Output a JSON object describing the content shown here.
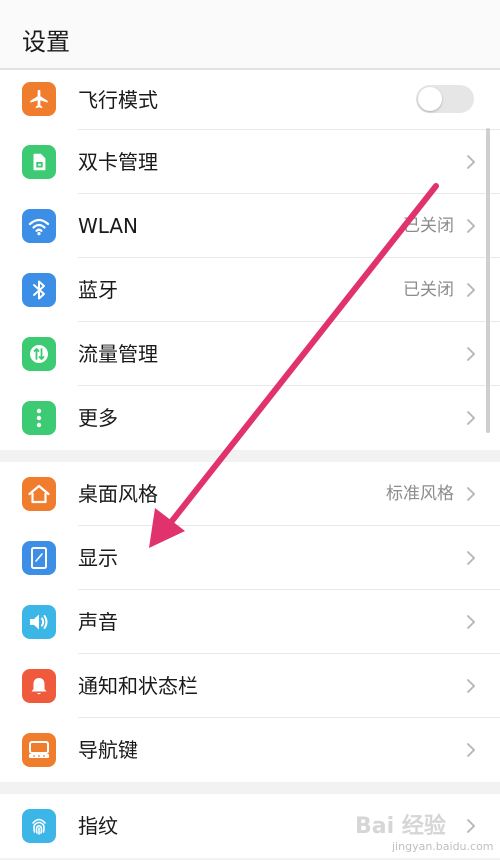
{
  "header": {
    "title": "设置"
  },
  "colors": {
    "airplane": "#f07d2d",
    "sim": "#3ccb73",
    "wlan": "#3c8ee6",
    "bluetooth": "#3c8ee6",
    "data": "#3ccb73",
    "more": "#3ccb73",
    "home_style": "#f07d2d",
    "display": "#3c8ee6",
    "sound": "#3cb6e6",
    "notify": "#f05a3c",
    "navkey": "#f07d2d",
    "fingerprint": "#3cb6e6",
    "annotation_arrow": "#e0336e"
  },
  "groups": [
    {
      "items": [
        {
          "icon": "airplane-icon",
          "label": "飞行模式",
          "toggle_on": false
        },
        {
          "icon": "sim-card-icon",
          "label": "双卡管理",
          "value": ""
        },
        {
          "icon": "wifi-icon",
          "label": "WLAN",
          "value": "已关闭"
        },
        {
          "icon": "bluetooth-icon",
          "label": "蓝牙",
          "value": "已关闭"
        },
        {
          "icon": "data-usage-icon",
          "label": "流量管理",
          "value": ""
        },
        {
          "icon": "more-dots-icon",
          "label": "更多",
          "value": ""
        }
      ]
    },
    {
      "items": [
        {
          "icon": "home-icon",
          "label": "桌面风格",
          "value": "标准风格"
        },
        {
          "icon": "display-icon",
          "label": "显示",
          "value": ""
        },
        {
          "icon": "speaker-icon",
          "label": "声音",
          "value": ""
        },
        {
          "icon": "bell-icon",
          "label": "通知和状态栏",
          "value": ""
        },
        {
          "icon": "nav-key-icon",
          "label": "导航键",
          "value": ""
        }
      ]
    },
    {
      "items": [
        {
          "icon": "fingerprint-icon",
          "label": "指纹",
          "value": ""
        }
      ]
    }
  ],
  "watermark": {
    "text": "Bai 经验",
    "sub": "jingyan.baidu.com"
  }
}
